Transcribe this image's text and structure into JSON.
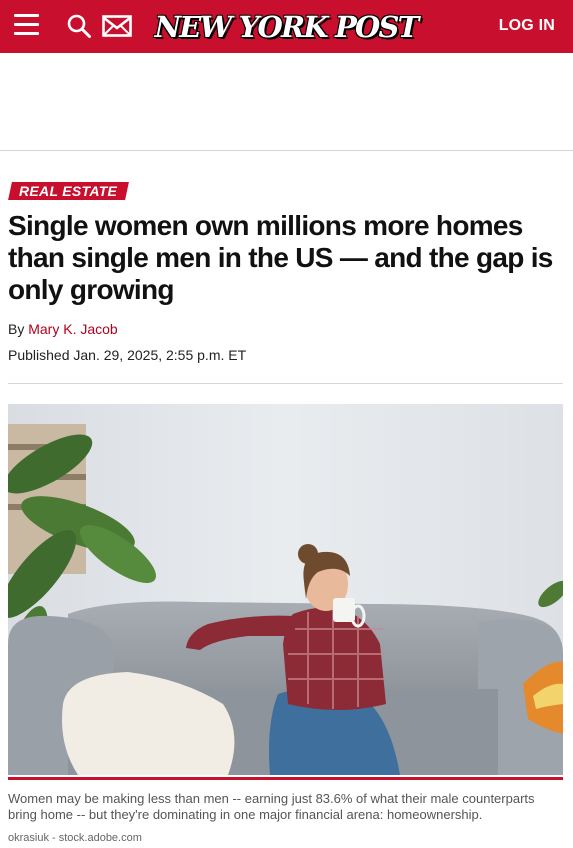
{
  "header": {
    "logo_text": "NEW YORK POST",
    "login_label": "LOG IN",
    "icons": [
      "menu-icon",
      "search-icon",
      "mail-icon"
    ],
    "background_color": "#c8102e"
  },
  "article": {
    "category": "REAL ESTATE",
    "headline": "Single women own millions more homes than single men in the US — and the gap is only growing",
    "byline_prefix": "By",
    "author": "Mary K. Jacob",
    "published": "Published Jan. 29, 2025, 2:55 p.m. ET",
    "image": {
      "caption": "Women may be making less than men -- earning just 83.6% of what their male counterparts bring home -- but they're dominating in one major financial arena: homeownership.",
      "credit": "okrasiuk - stock.adobe.com"
    }
  },
  "colors": {
    "brand_red": "#c8102e",
    "author_link": "#b3001b"
  }
}
